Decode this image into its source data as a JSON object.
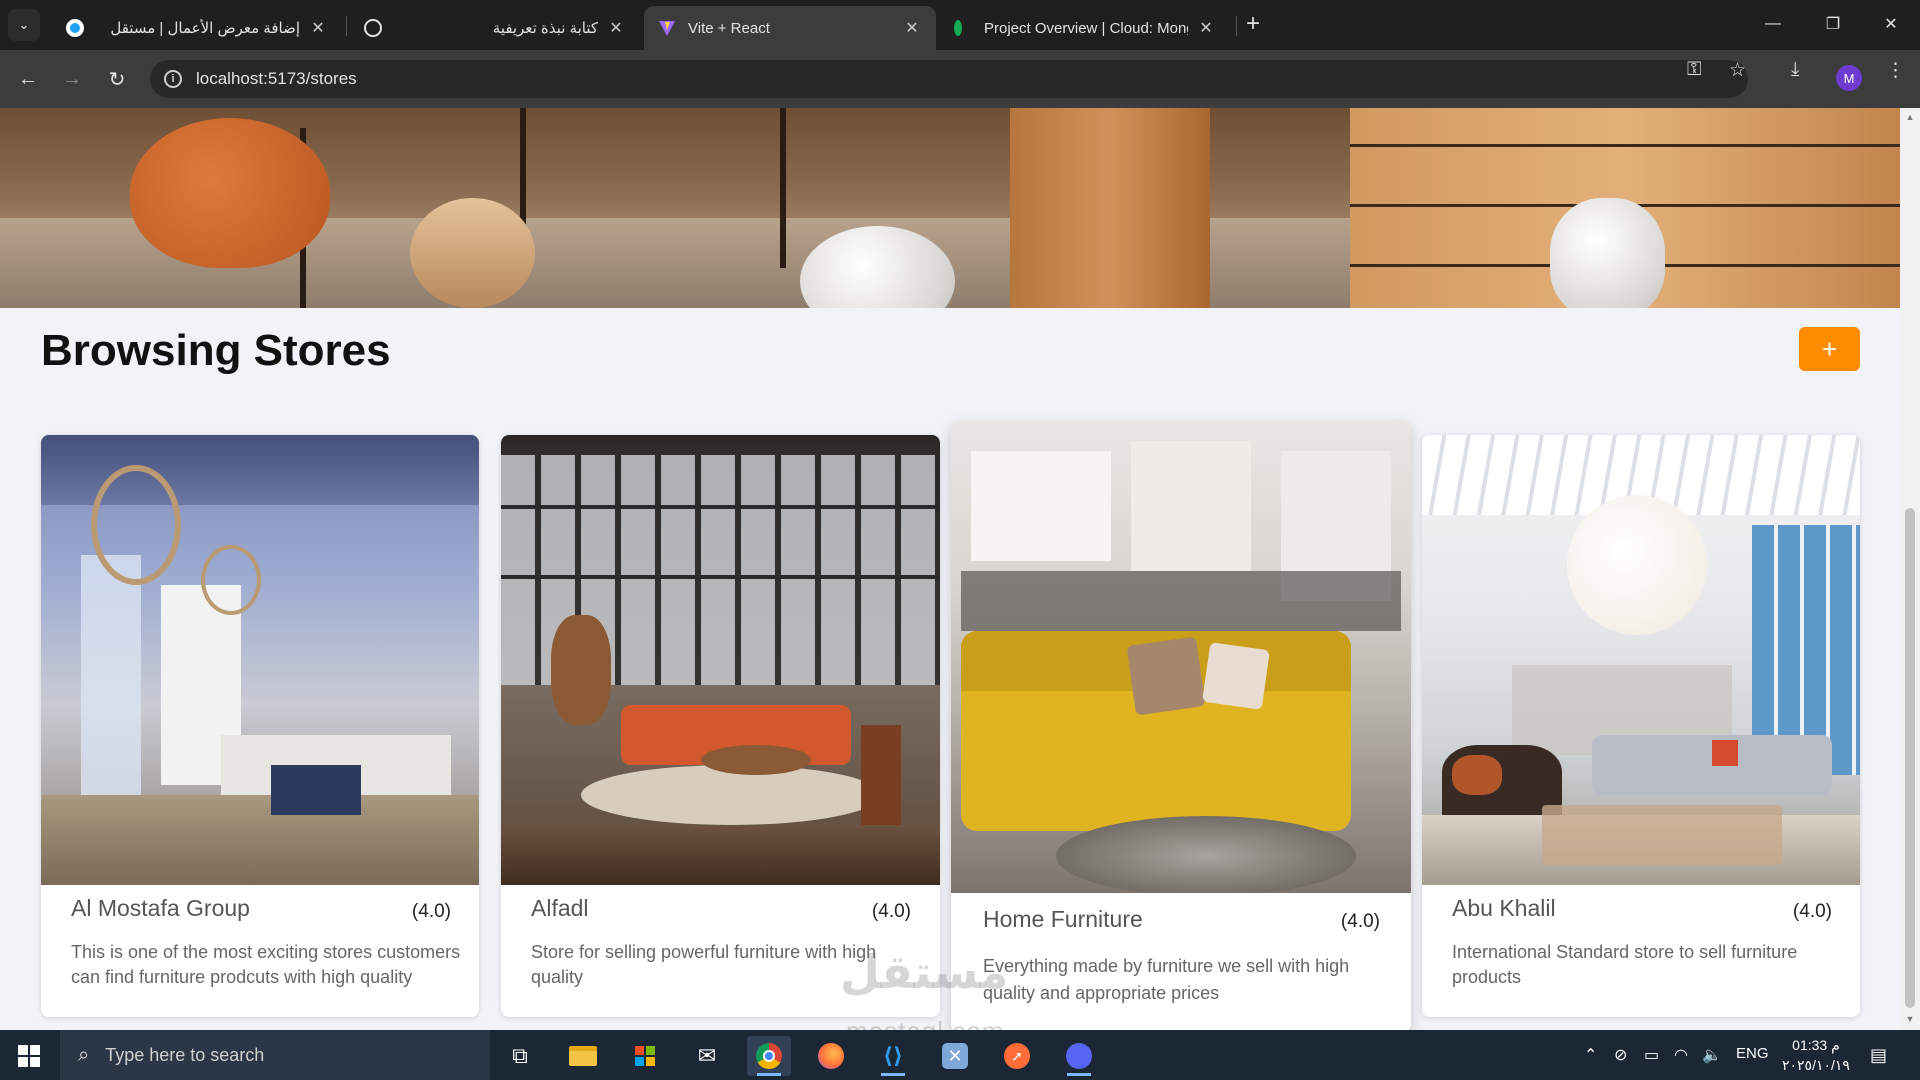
{
  "browser": {
    "tabs": [
      {
        "title": "إضافة معرض الأعمال | مستقل",
        "active": false
      },
      {
        "title": "كتابة نبذة تعريفية",
        "active": false
      },
      {
        "title": "Vite + React",
        "active": true
      },
      {
        "title": "Project Overview | Cloud: Mong",
        "active": false
      }
    ],
    "url": "localhost:5173/stores",
    "profile_initial": "M"
  },
  "page": {
    "heading": "Browsing Stores",
    "add_button_label": "+",
    "accent_color": "#ff8c00",
    "stores": [
      {
        "name": "Al Mostafa Group",
        "rating": "(4.0)",
        "description": "This is one of the most exciting stores customers can find furniture prodcuts with high quality"
      },
      {
        "name": "Alfadl",
        "rating": "(4.0)",
        "description": "Store for selling powerful furniture with high quality"
      },
      {
        "name": "Home Furniture",
        "rating": "(4.0)",
        "description": "Everything made by furniture we sell with high quality and appropriate prices"
      },
      {
        "name": "Abu Khalil",
        "rating": "(4.0)",
        "description": "International Standard store to sell furniture products"
      }
    ]
  },
  "watermark": {
    "text": "مستقل",
    "domain": "mostaql.com"
  },
  "taskbar": {
    "search_placeholder": "Type here to search",
    "language": "ENG",
    "time": "01:33 م",
    "date": "٢٠٢٥/١٠/١٩"
  }
}
